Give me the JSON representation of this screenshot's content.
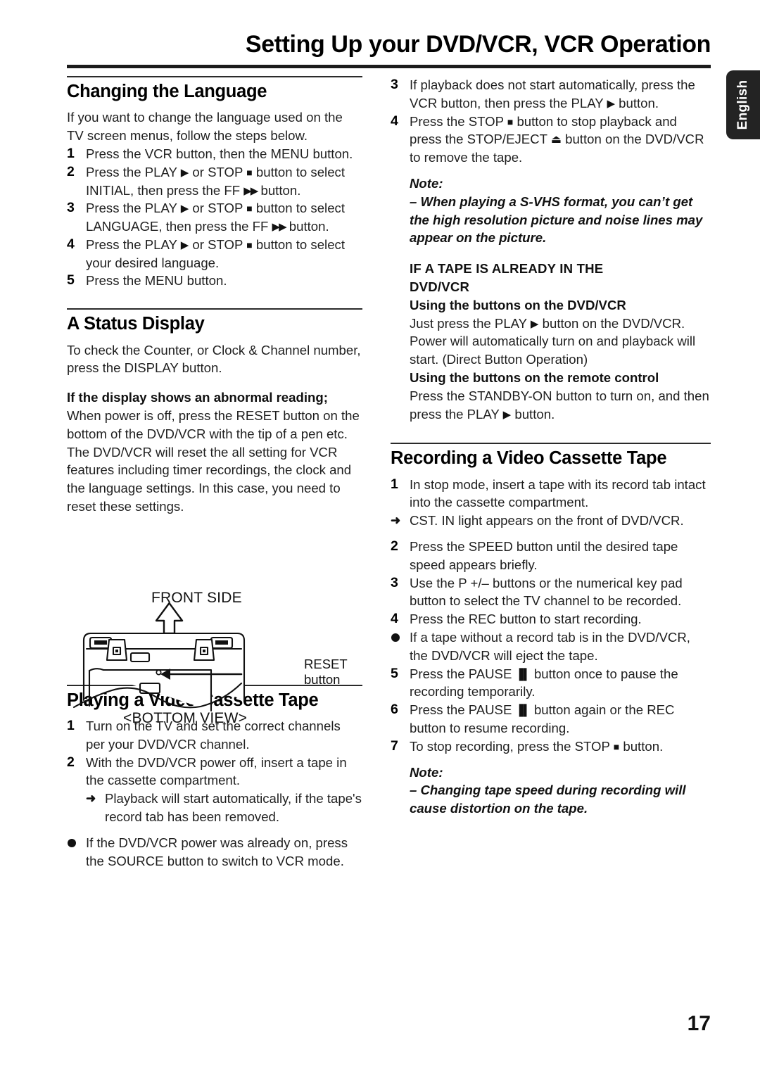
{
  "page": {
    "title": "Setting Up your DVD/VCR, VCR Operation",
    "number": "17",
    "language_tab": "English"
  },
  "left_column": {
    "section_language": {
      "heading": "Changing the Language",
      "intro": "If you want to change the language used on the TV screen menus, follow the steps below.",
      "steps": [
        {
          "num": "1",
          "text": "Press the VCR button, then the MENU button."
        },
        {
          "num": "2",
          "text_a": "Press the PLAY ",
          "text_b": " or STOP ",
          "text_c": " button to select INITIAL, then press the FF ",
          "text_d": " button."
        },
        {
          "num": "3",
          "text_a": "Press the PLAY ",
          "text_b": " or STOP ",
          "text_c": " button to select LANGUAGE, then press the FF ",
          "text_d": " button."
        },
        {
          "num": "4",
          "text_a": "Press the PLAY ",
          "text_b": " or STOP ",
          "text_c": " button to select your desired language."
        },
        {
          "num": "5",
          "text": "Press the MENU button."
        }
      ]
    },
    "section_status": {
      "heading": "A Status Display",
      "intro": "To check the Counter, or Clock & Channel number, press the DISPLAY button.",
      "subheading": "If the display shows an abnormal reading;",
      "body": "When power is off, press the RESET button on the bottom of the DVD/VCR with the tip of a pen etc. The DVD/VCR will reset the all setting for VCR features including timer recordings, the clock and the language settings. In this case, you need to reset these settings."
    },
    "figure": {
      "front_label": "FRONT SIDE",
      "bottom_label": "<BOTTOM VIEW>",
      "reset_label_line1": "RESET",
      "reset_label_line2": "button"
    },
    "section_playing": {
      "heading": "Playing a Video Cassette Tape",
      "steps": [
        {
          "num": "1",
          "text": "Turn on the TV and set the correct channels per your DVD/VCR channel."
        },
        {
          "num": "2",
          "text": "With the DVD/VCR power off, insert a tape in the cassette compartment."
        }
      ],
      "sub_note": "Playback will start automatically, if the tape's record tab has been removed.",
      "bullet": "If the DVD/VCR power was already on, press the SOURCE button to switch to VCR mode."
    }
  },
  "right_column": {
    "playing_continued": {
      "steps": [
        {
          "num": "3",
          "text_a": "If playback does not start automatically, press the VCR button, then press the PLAY ",
          "text_b": " button."
        },
        {
          "num": "4",
          "text_a": "Press the STOP ",
          "text_b": " button to stop playback and press the STOP/EJECT ",
          "text_c": " button on the DVD/VCR to remove the tape."
        }
      ],
      "note_label": "Note:",
      "note_body": "– When playing a S-VHS format, you can’t get the high resolution picture and noise lines may appear on the picture."
    },
    "tape_already_in": {
      "heading_line1": "IF A TAPE IS ALREADY IN THE",
      "heading_line2": "DVD/VCR",
      "sub1": "Using the buttons on the DVD/VCR",
      "sub1_body_a": "Just press the PLAY ",
      "sub1_body_b": " button on the DVD/VCR. Power will automatically turn on and playback will start. (Direct Button Operation)",
      "sub2": "Using the buttons on the remote control",
      "sub2_body_a": "Press the STANDBY-ON button to turn on, and then press the PLAY ",
      "sub2_body_b": " button."
    },
    "section_recording": {
      "heading": "Recording a Video Cassette Tape",
      "steps": [
        {
          "num": "1",
          "text": "In stop mode, insert a tape with its record tab intact into the cassette compartment."
        }
      ],
      "sub_note": "CST. IN light appears on the front of DVD/VCR.",
      "steps2": [
        {
          "num": "2",
          "text": "Press the SPEED button until the desired tape speed appears briefly."
        },
        {
          "num": "3",
          "text": "Use the P +/– buttons or the numerical key pad button to select the TV channel to be recorded."
        },
        {
          "num": "4",
          "text": "Press the REC button to start recording."
        }
      ],
      "bullet": "If a tape without a record tab is in the DVD/VCR, the DVD/VCR will eject the tape.",
      "steps3": [
        {
          "num": "5",
          "text_a": "Press the PAUSE ",
          "text_b": " button once to pause the recording temporarily."
        },
        {
          "num": "6",
          "text_a": "Press the PAUSE ",
          "text_b": " button again or the REC button to resume recording."
        },
        {
          "num": "7",
          "text_a": "To stop recording, press the STOP ",
          "text_b": " button."
        }
      ],
      "note_label": "Note:",
      "note_body": "– Changing tape speed during recording will cause distortion on the tape."
    }
  }
}
